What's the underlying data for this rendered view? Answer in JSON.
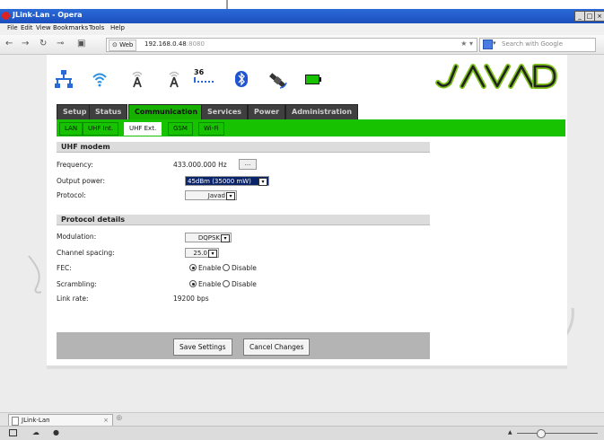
{
  "window": {
    "title": "JLink-Lan - Opera"
  },
  "menu": [
    "File",
    "Edit",
    "View",
    "Bookmarks",
    "Tools",
    "Help"
  ],
  "address": {
    "chip": "Web",
    "host": "192.168.0.48",
    "port": ":8080"
  },
  "search": {
    "placeholder": "Search with Google"
  },
  "status_icons": {
    "network": "network-icon",
    "wifi": "wifi-icon",
    "antenna1": "antenna-icon",
    "antenna2": "antenna-icon",
    "signal_count": "36",
    "bluetooth": "bluetooth-icon",
    "satellite": "satellite-icon",
    "battery": "battery-icon"
  },
  "brand": {
    "logo": "JAVAD",
    "accent": "#17c200"
  },
  "main_tabs": [
    "Setup",
    "Status",
    "Communication",
    "Services",
    "Power",
    "Administration"
  ],
  "sub_tabs": [
    "LAN",
    "UHF Int.",
    "UHF Ext.",
    "GSM",
    "Wi-Fi"
  ],
  "uhf_modem": {
    "heading": "UHF modem",
    "frequency_label": "Frequency:",
    "frequency_value": "433.000.000 Hz",
    "frequency_button": "...",
    "power_label": "Output power:",
    "power_value": "45dBm (35000 mW)",
    "protocol_label": "Protocol:",
    "protocol_value": "Javad"
  },
  "protocol_details": {
    "heading": "Protocol details",
    "modulation_label": "Modulation:",
    "modulation_value": "DQPSK",
    "spacing_label": "Channel spacing:",
    "spacing_value": "25.0",
    "fec_label": "FEC:",
    "scrambling_label": "Scrambling:",
    "enable_label": "Enable",
    "disable_label": "Disable",
    "linkrate_label": "Link rate:",
    "linkrate_value": "19200 bps"
  },
  "buttons": {
    "save": "Save Settings",
    "cancel": "Cancel Changes"
  },
  "browser_tab": {
    "title": "JLink-Lan"
  }
}
